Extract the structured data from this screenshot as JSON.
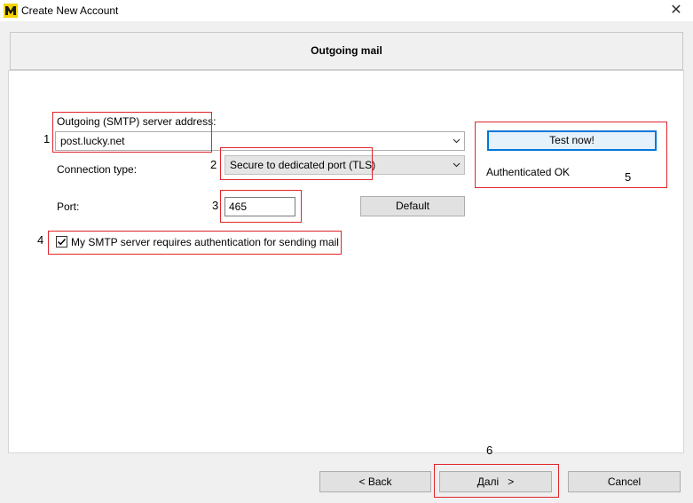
{
  "window": {
    "title": "Create New Account",
    "close_glyph": "✕"
  },
  "header": {
    "title": "Outgoing mail"
  },
  "smtp": {
    "server_label": "Outgoing (SMTP) server address:",
    "server_value": "post.lucky.net",
    "connection_label": "Connection type:",
    "connection_value": "Secure to dedicated port (TLS)",
    "port_label": "Port:",
    "port_value": "465",
    "default_button": "Default",
    "auth_label": "My SMTP server requires authentication for sending mail",
    "auth_checked": true
  },
  "test": {
    "button_label": "Test now!",
    "status": "Authenticated OK"
  },
  "annotations": [
    "1",
    "2",
    "3",
    "4",
    "5",
    "6"
  ],
  "footer": {
    "back_label": "< Back",
    "next_label": "Далі   >",
    "cancel_label": "Cancel"
  },
  "colors": {
    "annotation_red": "#e0262c",
    "focus_blue": "#0078d7"
  }
}
